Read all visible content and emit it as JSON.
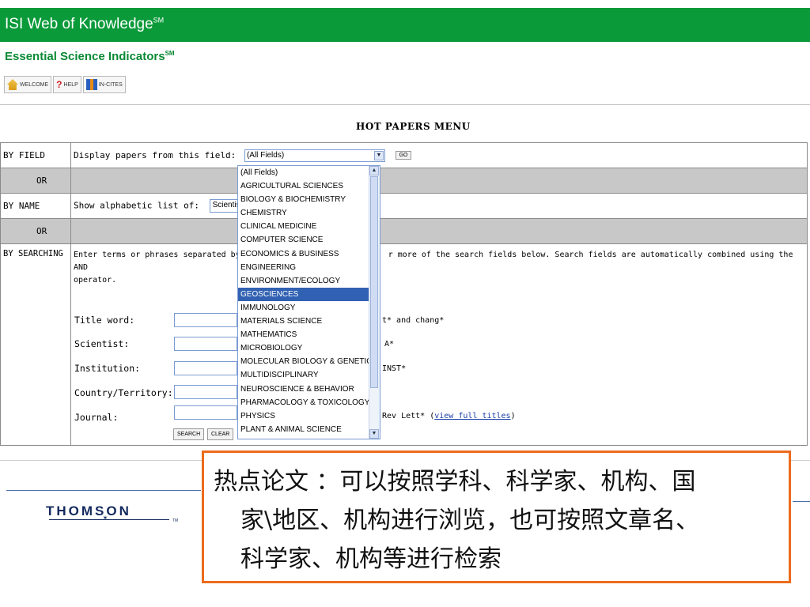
{
  "header": {
    "title": "ISI Web of Knowledge",
    "title_mark": "SM"
  },
  "subheader": {
    "title": "Essential Science Indicators",
    "title_mark": "SM"
  },
  "nav": {
    "welcome": "WELCOME",
    "help": "HELP",
    "incites": "IN-CITES"
  },
  "menu_title": "HOT PAPERS MENU",
  "by_field": {
    "label": "BY FIELD",
    "prompt": "Display papers from this field:",
    "selected": "(All Fields)",
    "go": "GO"
  },
  "or_label": "OR",
  "by_name": {
    "label": "BY NAME",
    "prompt": "Show alphabetic list of:",
    "selected": "Scientist"
  },
  "by_searching": {
    "label": "BY SEARCHING",
    "instructions_left": "Enter terms or phrases separated by",
    "instructions_right": "r more of the search fields below. Search fields are automatically combined using the AND",
    "instructions_cont": "operator.",
    "fields": [
      {
        "label": "Title word:",
        "example": "t* and chang*"
      },
      {
        "label": "Scientist:",
        "example": "A*"
      },
      {
        "label": "Institution:",
        "example": "INST*"
      },
      {
        "label": "Country/Territory:",
        "example": ""
      },
      {
        "label": "Journal:",
        "example": "Rev Lett*",
        "link": "view full titles"
      }
    ],
    "search_btn": "SEARCH",
    "clear_btn": "CLEAR"
  },
  "field_options": [
    "(All Fields)",
    "AGRICULTURAL SCIENCES",
    "BIOLOGY & BIOCHEMISTRY",
    "CHEMISTRY",
    "CLINICAL MEDICINE",
    "COMPUTER SCIENCE",
    "ECONOMICS & BUSINESS",
    "ENGINEERING",
    "ENVIRONMENT/ECOLOGY",
    "GEOSCIENCES",
    "IMMUNOLOGY",
    "MATERIALS SCIENCE",
    "MATHEMATICS",
    "MICROBIOLOGY",
    "MOLECULAR BIOLOGY & GENETICS",
    "MULTIDISCIPLINARY",
    "NEUROSCIENCE & BEHAVIOR",
    "PHARMACOLOGY & TOXICOLOGY",
    "PHYSICS",
    "PLANT & ANIMAL SCIENCE"
  ],
  "highlighted_option": "GEOSCIENCES",
  "footer": {
    "logo_text": "THOMSON",
    "logo_tm": "TM"
  },
  "callout": {
    "line1": "热点论文 ：可以按照学科、科学家、机构、国",
    "line2": "家\\地区、机构进行浏览，也可按照文章名、",
    "line3": "科学家、机构等进行检索"
  },
  "colors": {
    "header_green": "#0b9a3a",
    "callout_border": "#ec6b1d",
    "highlight_blue": "#3161b2"
  }
}
